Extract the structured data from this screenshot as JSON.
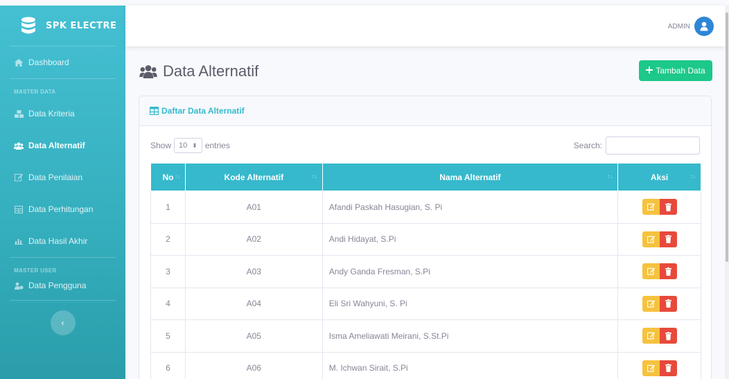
{
  "brand": {
    "name": "SPK ELECTRE"
  },
  "sidebar": {
    "dashboard": "Dashboard",
    "heading_master_data": "MASTER DATA",
    "items": [
      "Data Kriteria",
      "Data Alternatif",
      "Data Penilaian",
      "Data Perhitungan",
      "Data Hasil Akhir"
    ],
    "heading_master_user": "MASTER USER",
    "user_item": "Data Pengguna",
    "toggle": "‹"
  },
  "topbar": {
    "username": "ADMIN"
  },
  "page": {
    "title": "Data Alternatif",
    "add_button": "Tambah Data"
  },
  "card": {
    "title": "Daftar Data Alternatif"
  },
  "controls": {
    "show": "Show",
    "entries_value": "10",
    "entries": "entries",
    "search": "Search:"
  },
  "table": {
    "headers": {
      "no": "No",
      "kode": "Kode Alternatif",
      "nama": "Nama Alternatif",
      "aksi": "Aksi"
    },
    "rows": [
      {
        "no": "1",
        "kode": "A01",
        "nama": "Afandi Paskah Hasugian, S. Pi"
      },
      {
        "no": "2",
        "kode": "A02",
        "nama": "Andi Hidayat, S.Pi"
      },
      {
        "no": "3",
        "kode": "A03",
        "nama": "Andy Ganda Fresman, S.Pi"
      },
      {
        "no": "4",
        "kode": "A04",
        "nama": "Eli Sri Wahyuni, S. Pi"
      },
      {
        "no": "5",
        "kode": "A05",
        "nama": "Isma Ameliawati Meirani, S.St.Pi"
      },
      {
        "no": "6",
        "kode": "A06",
        "nama": "M. Ichwan Sirait, S.Pi"
      }
    ]
  },
  "colors": {
    "sidebar": "#36b9cc",
    "success": "#1cc88a",
    "warning": "#f6c23e",
    "danger": "#e74a3b"
  }
}
